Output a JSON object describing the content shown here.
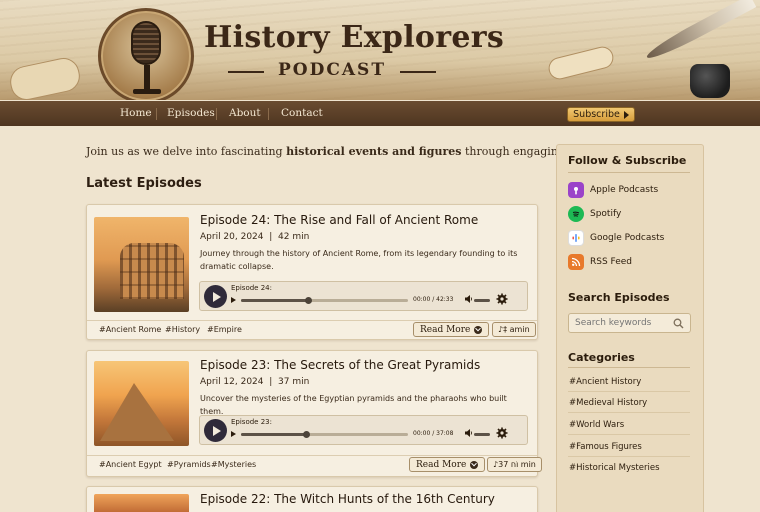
{
  "brand": {
    "title": "History Explorers",
    "subtitle": "PODCAST"
  },
  "nav": {
    "items": [
      "Home",
      "Episodes",
      "About",
      "Contact"
    ],
    "subscribe_label": "Subscribe"
  },
  "intro": {
    "before": "Join us as we delve into fascinating ",
    "bold": "historical events and figures",
    "after": " through engaging stories."
  },
  "latest": {
    "title": "Latest Episodes"
  },
  "episodes": [
    {
      "title": "Episode 24: The Rise and Fall of Ancient Rome",
      "date": "April 20, 2024",
      "duration": "42 min",
      "description": "Journey through the history of Ancient Rome, from its legendary founding to its dramatic collapse.",
      "player_label": "Episode 24:",
      "time": "00:00 / 42:33",
      "progress": 0.4,
      "tags": [
        "#Ancient Rome",
        "#History",
        "#Empire"
      ],
      "read_more": "Read More",
      "lang_label": "♪‡ amin"
    },
    {
      "title": "Episode 23: The Secrets of the Great Pyramids",
      "date": "April 12, 2024",
      "duration": "37 min",
      "description": "Uncover the mysteries of the Egyptian pyramids and the pharaohs who built them.",
      "player_label": "Episode 23:",
      "time": "00:00 / 37:08",
      "progress": 0.39,
      "tags": [
        "#Ancient Egypt",
        "#Pyramids",
        "#Mysteries"
      ],
      "read_more": "Read More",
      "lang_label": "♪וֹח 37 min"
    },
    {
      "title": "Episode 22: The Witch Hunts of the 16th Century"
    }
  ],
  "sidebar": {
    "follow_title": "Follow & Subscribe",
    "follow_items": [
      {
        "label": "Apple Podcasts",
        "icon": "apple-podcasts-icon",
        "color": "#9b43c9"
      },
      {
        "label": "Spotify",
        "icon": "spotify-icon",
        "color": "#1db954"
      },
      {
        "label": "Google Podcasts",
        "icon": "google-podcasts-icon",
        "color": "#ffffff"
      },
      {
        "label": "RSS Feed",
        "icon": "rss-icon",
        "color": "#e8792b"
      }
    ],
    "search_title": "Search Episodes",
    "search_placeholder": "Search keywords",
    "categories_title": "Categories",
    "categories": [
      "#Ancient History",
      "#Medieval History",
      "#World Wars",
      "#Famous Figures",
      "#Historical Mysteries"
    ]
  }
}
